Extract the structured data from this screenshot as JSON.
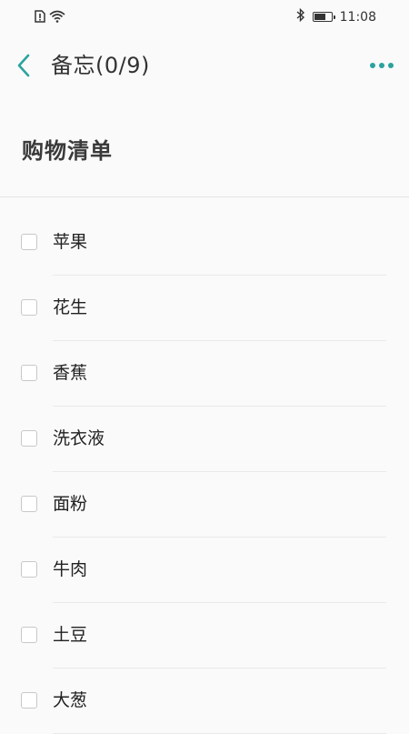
{
  "status_bar": {
    "time": "11:08",
    "battery_level": 0.7,
    "icons": [
      "alert-icon",
      "wifi-icon",
      "bluetooth-icon",
      "battery-icon"
    ]
  },
  "header": {
    "title": "备忘(0/9)",
    "back_icon": "chevron-left-icon",
    "more_icon": "more-dots-icon"
  },
  "note": {
    "title": "购物清单"
  },
  "checklist": {
    "checked_count": 0,
    "total_count": 9,
    "items": [
      {
        "label": "苹果",
        "checked": false
      },
      {
        "label": "花生",
        "checked": false
      },
      {
        "label": "香蕉",
        "checked": false
      },
      {
        "label": "洗衣液",
        "checked": false
      },
      {
        "label": "面粉",
        "checked": false
      },
      {
        "label": "牛肉",
        "checked": false
      },
      {
        "label": "土豆",
        "checked": false
      },
      {
        "label": "大葱",
        "checked": false
      }
    ]
  },
  "colors": {
    "accent": "#2aa39f",
    "background": "#fafafa",
    "divider": "#e3e3e3"
  }
}
